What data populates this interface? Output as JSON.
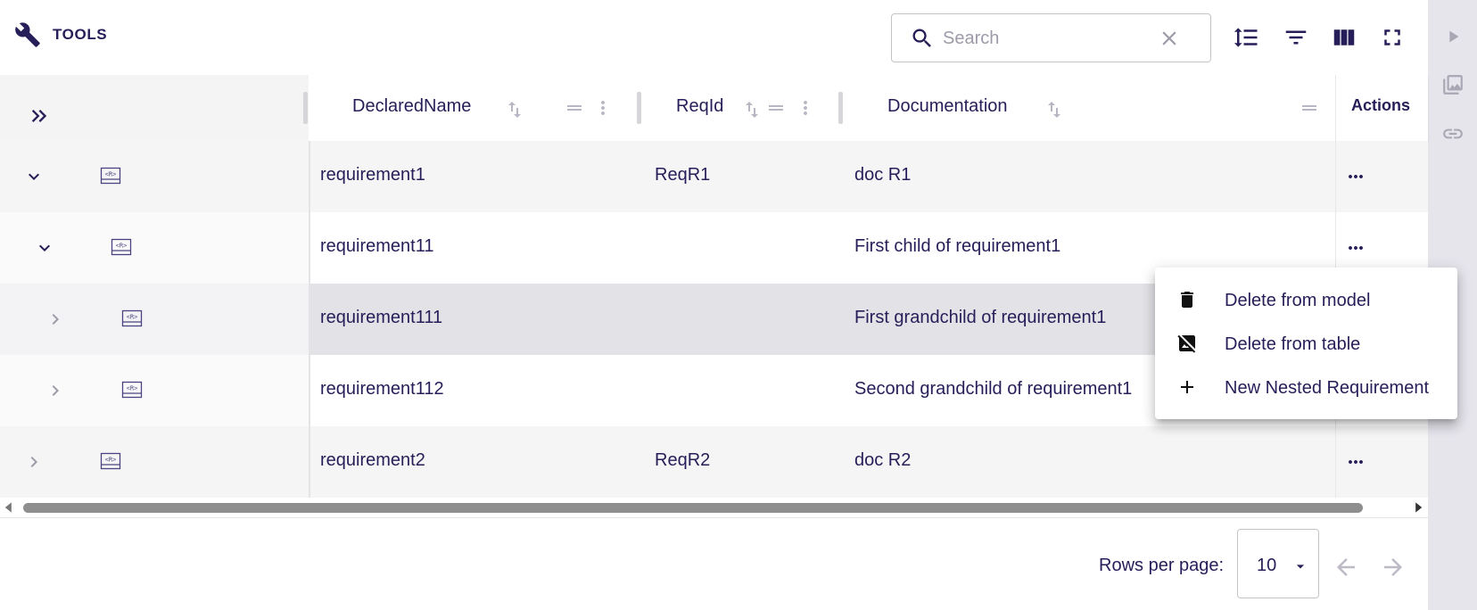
{
  "toolbar": {
    "title": "TOOLS",
    "search_placeholder": "Search",
    "search_value": ""
  },
  "table": {
    "columns": [
      {
        "label": "DeclaredName"
      },
      {
        "label": "ReqId"
      },
      {
        "label": "Documentation"
      }
    ],
    "actions_label": "Actions",
    "rows": [
      {
        "declared_name": "requirement1",
        "req_id": "ReqR1",
        "documentation": "doc R1",
        "level": 0,
        "expanded": true
      },
      {
        "declared_name": "requirement11",
        "req_id": "",
        "documentation": "First child of requirement1",
        "level": 1,
        "expanded": true
      },
      {
        "declared_name": "requirement111",
        "req_id": "",
        "documentation": "First grandchild of requirement1",
        "level": 2,
        "expanded": false,
        "selected": true
      },
      {
        "declared_name": "requirement112",
        "req_id": "",
        "documentation": "Second grandchild of requirement1",
        "level": 2,
        "expanded": false
      },
      {
        "declared_name": "requirement2",
        "req_id": "ReqR2",
        "documentation": "doc R2",
        "level": 0,
        "expanded": false
      }
    ]
  },
  "context_menu": {
    "items": [
      {
        "label": "Delete from model",
        "icon": "trash-icon"
      },
      {
        "label": "Delete from table",
        "icon": "hide-image-icon"
      },
      {
        "label": "New Nested Requirement",
        "icon": "plus-icon"
      }
    ]
  },
  "footer": {
    "rows_per_page_label": "Rows per page:",
    "rows_per_page_value": "10"
  },
  "colors": {
    "text": "#261e58",
    "row_alt": "#f5f5f5",
    "row_selected": "#e3e3e7",
    "rail": "#e6e5ec",
    "scroll_thumb": "#8e8e8e"
  }
}
